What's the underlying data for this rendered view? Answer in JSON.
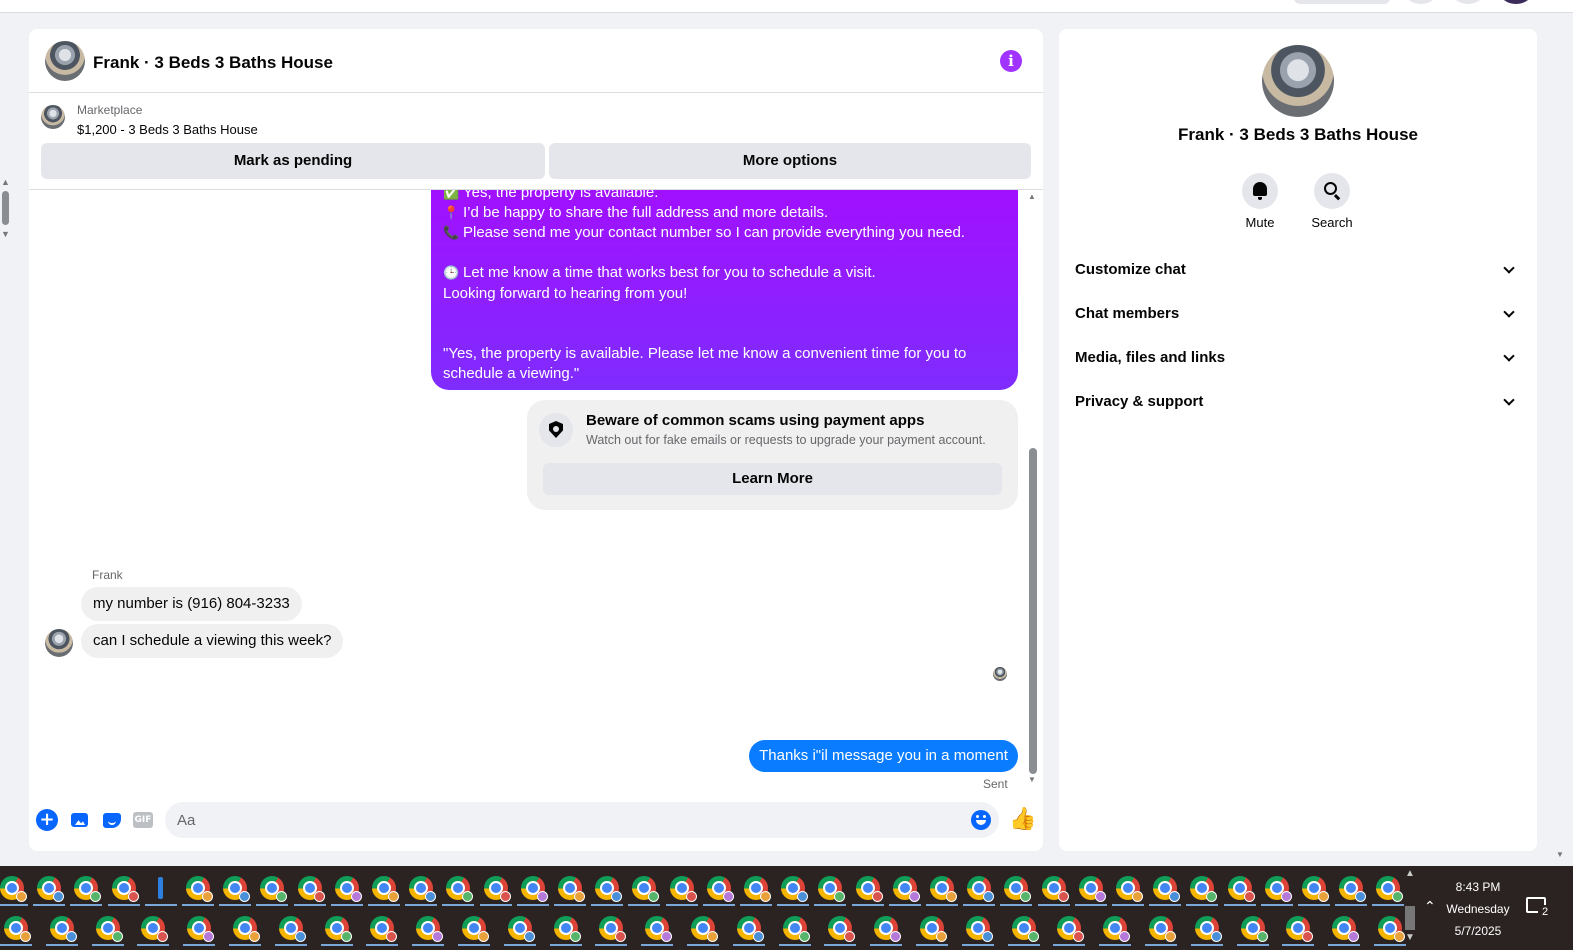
{
  "conversation": {
    "title": "Frank · 3 Beds 3 Baths House"
  },
  "listing": {
    "source": "Marketplace",
    "price_title": "$1,200 - 3 Beds 3 Baths House",
    "mark_pending_label": "Mark as pending",
    "more_options_label": "More options"
  },
  "messages": {
    "outgoing_lines": [
      {
        "icon": "✅",
        "text": "Yes, the property is available."
      },
      {
        "icon": "📍",
        "text": "I’d be happy to share the full address and more details."
      },
      {
        "icon": "📞",
        "text": "Please send me your contact number so I can provide everything you need."
      },
      {
        "icon": "🕒",
        "text": "Let me know a time that works best for you to schedule a visit."
      },
      {
        "icon": "",
        "text": "Looking forward to hearing from you!"
      },
      {
        "icon": "",
        "text": "\"Yes, the property is available. Please let me know a convenient time for you to"
      },
      {
        "icon": "",
        "text": "schedule a viewing.\""
      }
    ],
    "scam_notice": {
      "title": "Beware of common scams using payment apps",
      "body": "Watch out for fake emails or requests to upgrade your payment account.",
      "button": "Learn More"
    },
    "sender_name": "Frank",
    "incoming": [
      "my number is (916) 804-3233",
      "can I schedule a viewing this week?"
    ],
    "outgoing_reply": "Thanks i\"il message you in a moment",
    "status": "Sent"
  },
  "composer": {
    "placeholder": "Aa",
    "gif_label": "GIF",
    "icons": [
      "plus-icon",
      "photo-icon",
      "sticker-icon",
      "gif-icon",
      "emoji-icon",
      "thumbs-up-icon"
    ]
  },
  "details": {
    "name": "Frank · 3 Beds 3 Baths House",
    "actions": [
      {
        "label": "Mute",
        "icon": "bell-icon"
      },
      {
        "label": "Search",
        "icon": "search-icon"
      }
    ],
    "sections": [
      "Customize chat",
      "Chat members",
      "Media, files and links",
      "Privacy & support"
    ]
  },
  "taskbar": {
    "time": "8:43 PM",
    "day": "Wednesday",
    "date": "5/7/2025",
    "notification_count": "2"
  },
  "colors": {
    "accent_purple": "#a033ff",
    "messenger_blue": "#0a7cff",
    "bubble_gradient_top": "#a60cff",
    "bubble_gradient_bottom": "#7f2cff"
  }
}
